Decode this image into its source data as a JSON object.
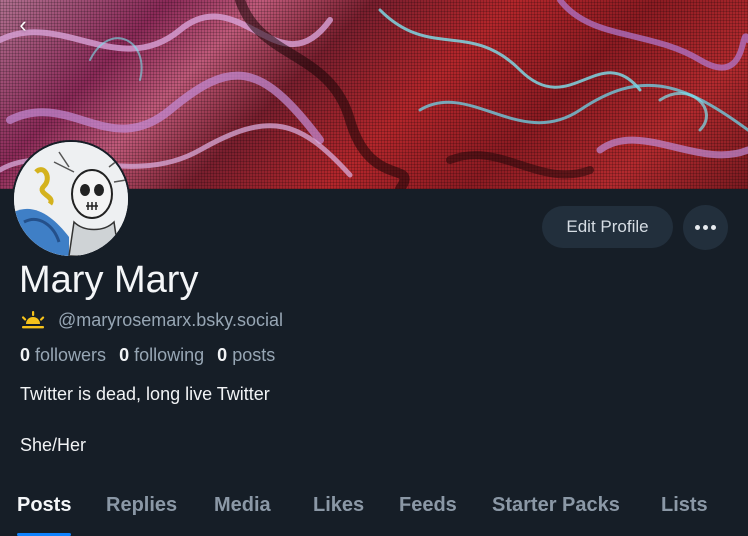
{
  "banner": {
    "alt": "marbled red and purple banner"
  },
  "navigation": {
    "back_icon": "chevron-left-icon",
    "back_glyph": "‹"
  },
  "profile": {
    "display_name": "Mary Mary",
    "handle": "@maryrosemarx.bsky.social",
    "handle_icon": "sun-icon",
    "bio": "Twitter is dead, long live Twitter",
    "pronouns": "She/Her"
  },
  "actions": {
    "edit_label": "Edit Profile",
    "more_icon": "ellipsis-icon"
  },
  "stats": {
    "followers_count": "0",
    "followers_label": "followers",
    "following_count": "0",
    "following_label": "following",
    "posts_count": "0",
    "posts_label": "posts"
  },
  "tabs": [
    {
      "label": "Posts",
      "active": true
    },
    {
      "label": "Replies",
      "active": false
    },
    {
      "label": "Media",
      "active": false
    },
    {
      "label": "Likes",
      "active": false
    },
    {
      "label": "Feeds",
      "active": false
    },
    {
      "label": "Starter Packs",
      "active": false
    },
    {
      "label": "Lists",
      "active": false
    }
  ],
  "colors": {
    "background": "#161e27",
    "accent": "#1083fe",
    "button_bg": "#222f3c",
    "muted_text": "#97a6b4",
    "sun_icon": "#f5c21b"
  }
}
